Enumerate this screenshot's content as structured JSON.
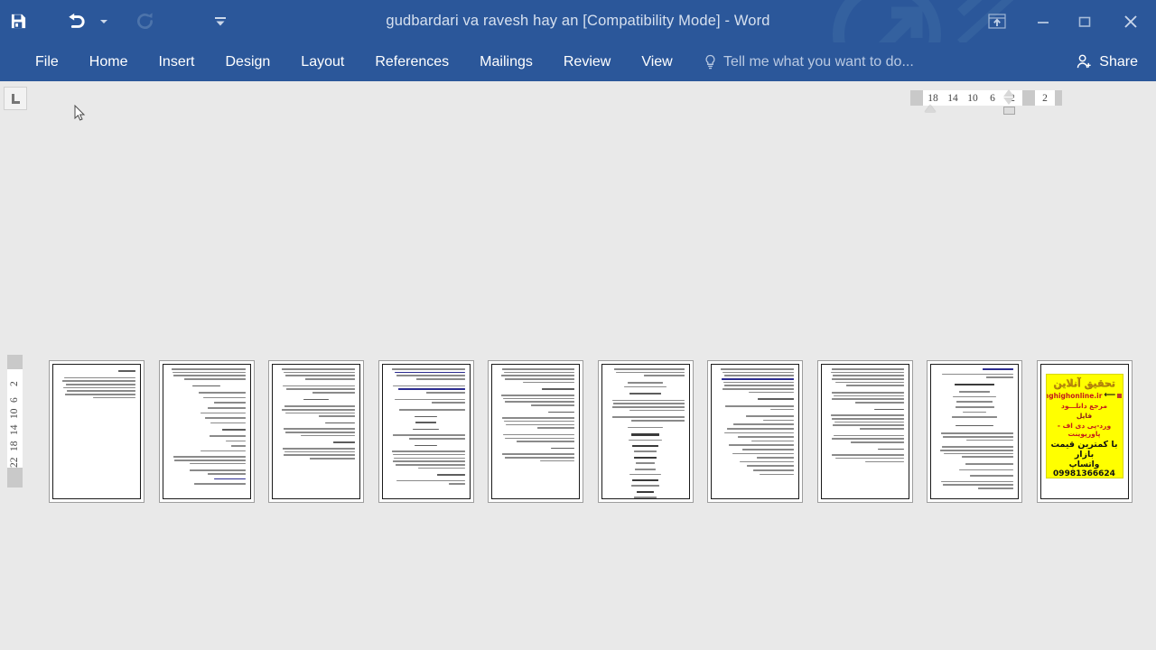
{
  "window": {
    "title": "gudbardari va ravesh hay an [Compatibility Mode] - Word",
    "quick_access": [
      {
        "name": "save",
        "icon": "save-icon",
        "label": "Save"
      },
      {
        "name": "undo",
        "icon": "undo-icon",
        "label": "Undo"
      },
      {
        "name": "redo",
        "icon": "redo-icon",
        "label": "Redo"
      },
      {
        "name": "customize",
        "icon": "customize-quick-access-icon",
        "label": "Customize Quick Access Toolbar"
      }
    ],
    "controls": [
      {
        "name": "ribbon-display-options",
        "icon": "ribbon-display-options-icon",
        "glyph": ""
      },
      {
        "name": "minimize",
        "icon": "minimize-icon",
        "glyph": "—"
      },
      {
        "name": "restore",
        "icon": "restore-icon",
        "glyph": "□"
      },
      {
        "name": "close",
        "icon": "close-icon",
        "glyph": "✕"
      }
    ],
    "accent_color": "#2b579a",
    "canvas_color": "#e9e9e9"
  },
  "ribbon": {
    "tabs": [
      {
        "label": "File"
      },
      {
        "label": "Home"
      },
      {
        "label": "Insert"
      },
      {
        "label": "Design"
      },
      {
        "label": "Layout"
      },
      {
        "label": "References"
      },
      {
        "label": "Mailings"
      },
      {
        "label": "Review"
      },
      {
        "label": "View"
      }
    ],
    "tell_me": "Tell me what you want to do...",
    "share_label": "Share"
  },
  "rulers": {
    "tab_stop_type": "left-tab-stop",
    "horizontal_numbers": [
      "18",
      "14",
      "10",
      "6",
      "2",
      "2"
    ],
    "vertical_numbers": [
      "2",
      "2",
      "6",
      "10",
      "14",
      "18",
      "22"
    ]
  },
  "document": {
    "page_count": 10,
    "view_mode": "multiple-pages",
    "pages": [
      {
        "number": 1,
        "kind": "text"
      },
      {
        "number": 2,
        "kind": "text"
      },
      {
        "number": 3,
        "kind": "text"
      },
      {
        "number": 4,
        "kind": "text"
      },
      {
        "number": 5,
        "kind": "text"
      },
      {
        "number": 6,
        "kind": "text"
      },
      {
        "number": 7,
        "kind": "text"
      },
      {
        "number": 8,
        "kind": "text"
      },
      {
        "number": 9,
        "kind": "text"
      },
      {
        "number": 10,
        "kind": "advertisement"
      }
    ]
  },
  "ad_page": {
    "title": "تحقیق آنلاین",
    "site": "Tahghighonline.ir",
    "line1": "مرجع دانلـــود",
    "line2": "فایل",
    "line3": "ورد-پی دی اف - پاورپوینت",
    "line4": "با کمترین قیمت بازار",
    "phone": "09981366624",
    "phone_label": "واتساپ",
    "background_color": "#ffff00",
    "title_color": "#b8860b",
    "text_color": "#c41a1a"
  }
}
